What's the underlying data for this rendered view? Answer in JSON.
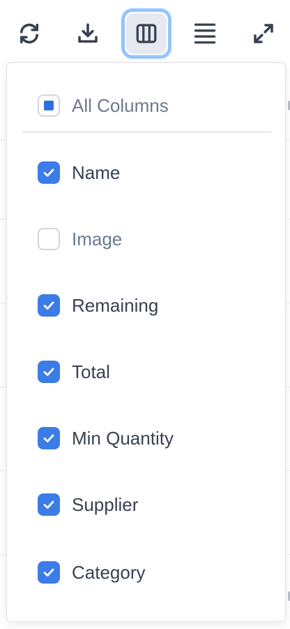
{
  "toolbar": {
    "buttons": [
      {
        "icon": "refresh-icon",
        "active": false
      },
      {
        "icon": "download-icon",
        "active": false
      },
      {
        "icon": "columns-icon",
        "active": true
      },
      {
        "icon": "density-icon",
        "active": false
      },
      {
        "icon": "fullscreen-icon",
        "active": false
      }
    ]
  },
  "column_menu": {
    "all_columns": {
      "label": "All Columns",
      "state": "indeterminate"
    },
    "columns": [
      {
        "label": "Name",
        "checked": true
      },
      {
        "label": "Image",
        "checked": false
      },
      {
        "label": "Remaining",
        "checked": true
      },
      {
        "label": "Total",
        "checked": true
      },
      {
        "label": "Min Quantity",
        "checked": true
      },
      {
        "label": "Supplier",
        "checked": true
      },
      {
        "label": "Category",
        "checked": true
      }
    ]
  },
  "colors": {
    "accent": "#3b7ce6",
    "active_ring": "#93c5fd",
    "text": "#374151",
    "muted_text": "#6b7a90"
  }
}
